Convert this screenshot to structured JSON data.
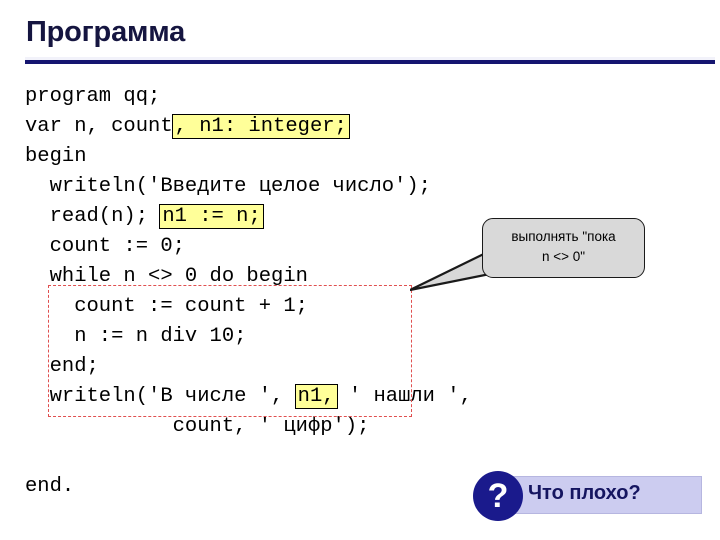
{
  "slide": {
    "title": "Программа",
    "accent_color": "#151570",
    "background": "#ffffff"
  },
  "code": {
    "language": "pascal",
    "lines": [
      {
        "id": "l1",
        "segments": [
          {
            "text": "program qq;",
            "highlight": "none"
          }
        ]
      },
      {
        "id": "l2",
        "segments": [
          {
            "text": "var n, count",
            "highlight": "none"
          },
          {
            "text": ", n1: integer;",
            "highlight": "yellow"
          }
        ]
      },
      {
        "id": "l3",
        "segments": [
          {
            "text": "begin",
            "highlight": "none"
          }
        ]
      },
      {
        "id": "l4",
        "segments": [
          {
            "text": "  writeln('Введите целое число');",
            "highlight": "none"
          }
        ]
      },
      {
        "id": "l5",
        "segments": [
          {
            "text": "  read(n); ",
            "highlight": "none"
          },
          {
            "text": "n1 := n;",
            "highlight": "yellow"
          }
        ]
      },
      {
        "id": "l6",
        "segments": [
          {
            "text": "  count := 0;",
            "highlight": "none"
          }
        ]
      },
      {
        "id": "l7",
        "segments": [
          {
            "text": "  while n <> 0 do begin",
            "highlight": "none"
          }
        ]
      },
      {
        "id": "l8",
        "segments": [
          {
            "text": "    count := count + 1;",
            "highlight": "none"
          }
        ]
      },
      {
        "id": "l9",
        "segments": [
          {
            "text": "    n := n div 10;",
            "highlight": "none"
          }
        ]
      },
      {
        "id": "l10",
        "segments": [
          {
            "text": "  end;",
            "highlight": "none"
          }
        ]
      },
      {
        "id": "l11",
        "segments": [
          {
            "text": "  writeln('В числе ', ",
            "highlight": "none"
          },
          {
            "text": "n1,",
            "highlight": "yellow"
          },
          {
            "text": " ' нашли ',",
            "highlight": "none"
          }
        ]
      },
      {
        "id": "l12",
        "segments": [
          {
            "text": "            count, ' цифр');",
            "highlight": "none"
          }
        ]
      },
      {
        "id": "l13",
        "segments": [
          {
            "text": "",
            "highlight": "none"
          }
        ]
      },
      {
        "id": "l14",
        "segments": [
          {
            "text": "end.",
            "highlight": "none"
          }
        ]
      }
    ],
    "highlight_color": "#ffff99"
  },
  "loop_box": {
    "border_color": "#e05050",
    "border_style": "dashed",
    "encloses": "while n <> 0 do begin ... end;"
  },
  "callout": {
    "text": "выполнять \"пока\nn <> 0\"",
    "line1": "выполнять \"пока",
    "line2": "n <> 0\"",
    "fill_color": "#d9d9d9",
    "points_to": "loop-box"
  },
  "question_banner": {
    "icon": "question-mark-icon",
    "icon_glyph": "?",
    "label": "Что плохо?",
    "circle_color": "#1a1a8c",
    "rect_color": "#ccccf0",
    "text_color": "#151560"
  }
}
